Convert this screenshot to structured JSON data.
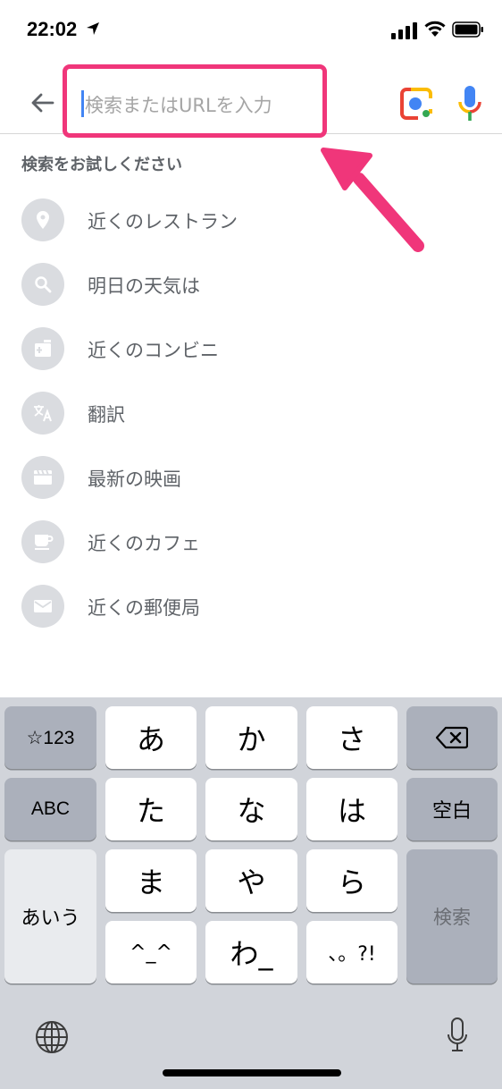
{
  "status_bar": {
    "time": "22:02",
    "location_icon": "location-arrow-icon",
    "signal_icon": "cellular-signal-icon",
    "wifi_icon": "wifi-icon",
    "battery_icon": "battery-icon"
  },
  "search": {
    "placeholder": "検索またはURLを入力",
    "back_icon": "back-arrow-icon",
    "lens_icon": "google-lens-icon",
    "mic_icon": "voice-search-mic-icon",
    "highlight_color": "#f0367a"
  },
  "suggestions": {
    "header": "検索をお試しください",
    "items": [
      {
        "label": "近くのレストラン",
        "icon": "location-pin-icon"
      },
      {
        "label": "明日の天気は",
        "icon": "search-icon"
      },
      {
        "label": "近くのコンビニ",
        "icon": "convenience-store-icon"
      },
      {
        "label": "翻訳",
        "icon": "translate-icon"
      },
      {
        "label": "最新の映画",
        "icon": "movie-clapper-icon"
      },
      {
        "label": "近くのカフェ",
        "icon": "coffee-cup-icon"
      },
      {
        "label": "近くの郵便局",
        "icon": "mail-envelope-icon"
      }
    ]
  },
  "keyboard": {
    "keys": {
      "sym": "☆123",
      "a": "あ",
      "ka": "か",
      "sa": "さ",
      "abc": "ABC",
      "ta": "た",
      "na": "な",
      "ha": "は",
      "space": "空白",
      "aiu": "あいう",
      "ma": "ま",
      "ya": "や",
      "ra": "ら",
      "search": "検索",
      "kaomoji": "^_^",
      "wa": "わ_",
      "punct": "、。?!"
    },
    "delete_icon": "backspace-icon",
    "globe_icon": "globe-icon",
    "mic_icon": "dictation-mic-icon"
  }
}
